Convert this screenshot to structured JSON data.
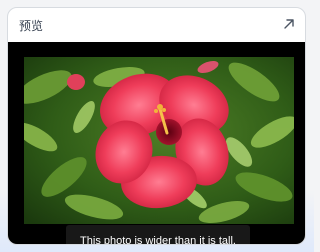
{
  "panel": {
    "title": "预览",
    "expand_icon": "arrow-up-right-icon"
  },
  "preview": {
    "image_subject": "red hibiscus flower",
    "caption": "This photo is wider than it is tall."
  },
  "colors": {
    "card_background": "#ffffff",
    "stage_background": "#000000",
    "caption_background": "#1c1c1c",
    "flower": "#e8344f"
  }
}
